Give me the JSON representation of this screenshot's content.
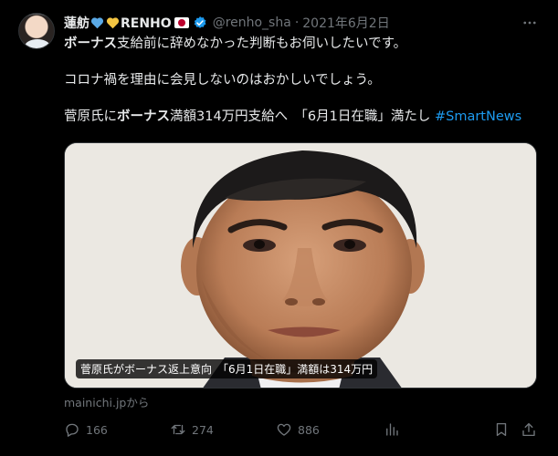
{
  "tweet": {
    "display_name": "蓮舫",
    "name_suffix": "RENHO",
    "handle": "@renho_sha",
    "separator": "·",
    "date": "2021年6月2日",
    "lines": {
      "l1_bold": "ボーナス",
      "l1_rest": "支給前に辞めなかった判断もお伺いしたいです。",
      "l2": "コロナ禍を理由に会見しないのはおかしいでしょう。",
      "l3_a": "菅原氏に",
      "l3_bold": "ボーナス",
      "l3_b": "満額314万円支給へ　「6月1日在職」満たし ",
      "l3_hashtag": "#SmartNews"
    },
    "card": {
      "caption": "菅原氏がボーナス返上意向　「6月1日在職」満額は314万円"
    },
    "source": "mainichi.jpから",
    "actions": {
      "replies": "166",
      "retweets": "274",
      "likes": "886"
    },
    "colors": {
      "accent": "#1d9bf0",
      "muted": "#71767b",
      "heart_blue": "#5aa9e6",
      "heart_yellow": "#f4c542"
    }
  }
}
